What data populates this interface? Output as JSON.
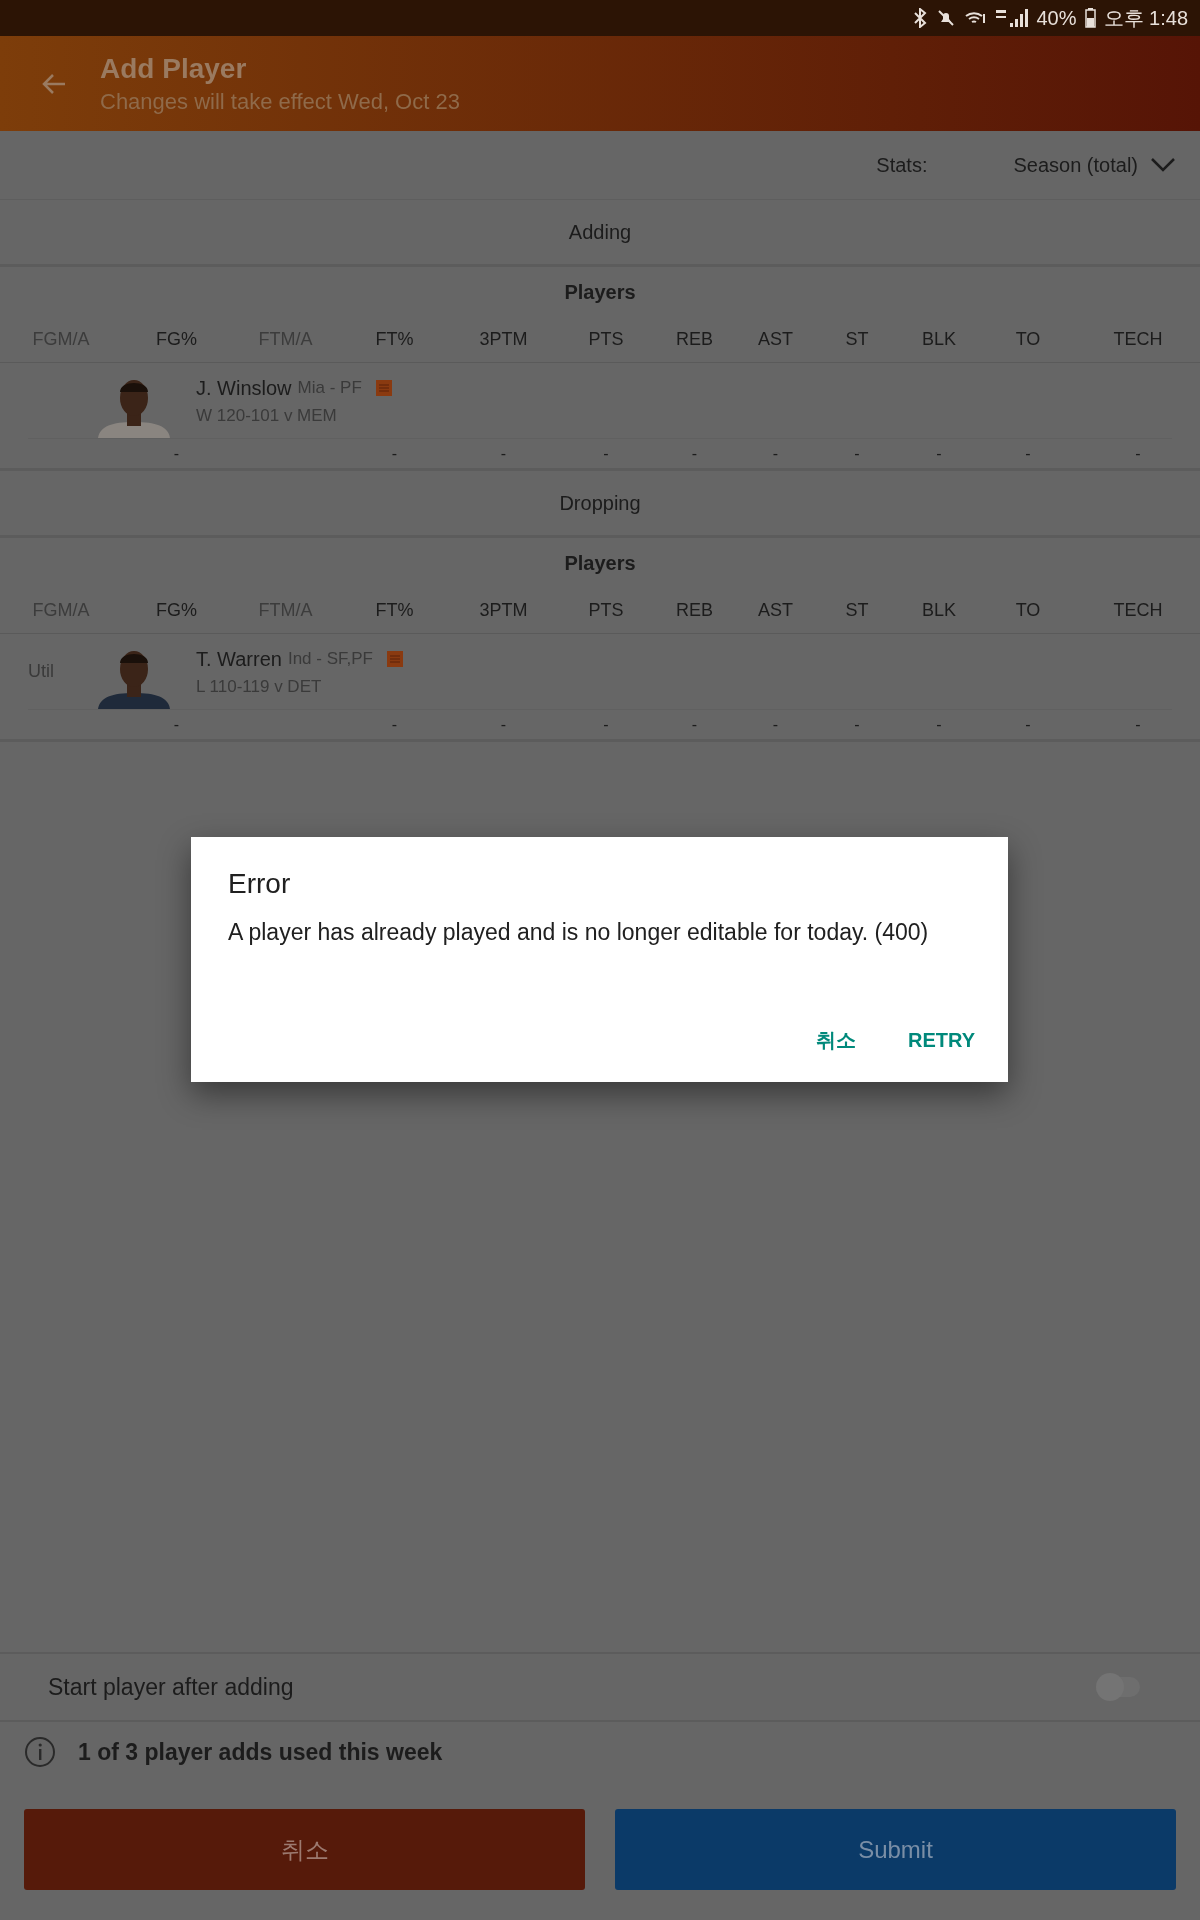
{
  "status_bar": {
    "battery": "40%",
    "time": "오후 1:48"
  },
  "header": {
    "title": "Add Player",
    "subtitle": "Changes will take effect Wed, Oct 23"
  },
  "stats_filter": {
    "label": "Stats:",
    "value": "Season (total)"
  },
  "sections": [
    {
      "title": "Adding",
      "table_title": "Players",
      "columns": [
        {
          "label": "FGM/A",
          "muted": true
        },
        {
          "label": "FG%",
          "muted": false,
          "value": "-"
        },
        {
          "label": "FTM/A",
          "muted": true
        },
        {
          "label": "FT%",
          "muted": false,
          "value": "-"
        },
        {
          "label": "3PTM",
          "muted": false,
          "value": "-"
        },
        {
          "label": "PTS",
          "muted": false,
          "value": "-"
        },
        {
          "label": "REB",
          "muted": false,
          "value": "-"
        },
        {
          "label": "AST",
          "muted": false,
          "value": "-"
        },
        {
          "label": "ST",
          "muted": false,
          "value": "-"
        },
        {
          "label": "BLK",
          "muted": false,
          "value": "-"
        },
        {
          "label": "TO",
          "muted": false,
          "value": "-"
        },
        {
          "label": "TECH",
          "muted": false,
          "value": "-"
        }
      ],
      "player": {
        "name": "J. Winslow",
        "team_position": "Mia - PF",
        "game": "W 120-101 v MEM"
      }
    },
    {
      "title": "Dropping",
      "table_title": "Players",
      "columns": [
        {
          "label": "FGM/A",
          "muted": true
        },
        {
          "label": "FG%",
          "muted": false,
          "value": "-"
        },
        {
          "label": "FTM/A",
          "muted": true
        },
        {
          "label": "FT%",
          "muted": false,
          "value": "-"
        },
        {
          "label": "3PTM",
          "muted": false,
          "value": "-"
        },
        {
          "label": "PTS",
          "muted": false,
          "value": "-"
        },
        {
          "label": "REB",
          "muted": false,
          "value": "-"
        },
        {
          "label": "AST",
          "muted": false,
          "value": "-"
        },
        {
          "label": "ST",
          "muted": false,
          "value": "-"
        },
        {
          "label": "BLK",
          "muted": false,
          "value": "-"
        },
        {
          "label": "TO",
          "muted": false,
          "value": "-"
        },
        {
          "label": "TECH",
          "muted": false,
          "value": "-"
        }
      ],
      "player": {
        "slot": "Util",
        "name": "T. Warren",
        "team_position": "Ind - SF,PF",
        "game": "L 110-119 v DET"
      }
    }
  ],
  "start_toggle": {
    "label": "Start player after adding",
    "on": false
  },
  "info": "1 of 3 player adds used this week",
  "buttons": [
    {
      "kind": "cancel",
      "label": "취소"
    },
    {
      "kind": "submit",
      "label": "Submit"
    }
  ],
  "dialog": {
    "title": "Error",
    "message": "A player has already played and is no longer editable for today. (400)",
    "buttons": [
      "취소",
      "RETRY"
    ]
  }
}
